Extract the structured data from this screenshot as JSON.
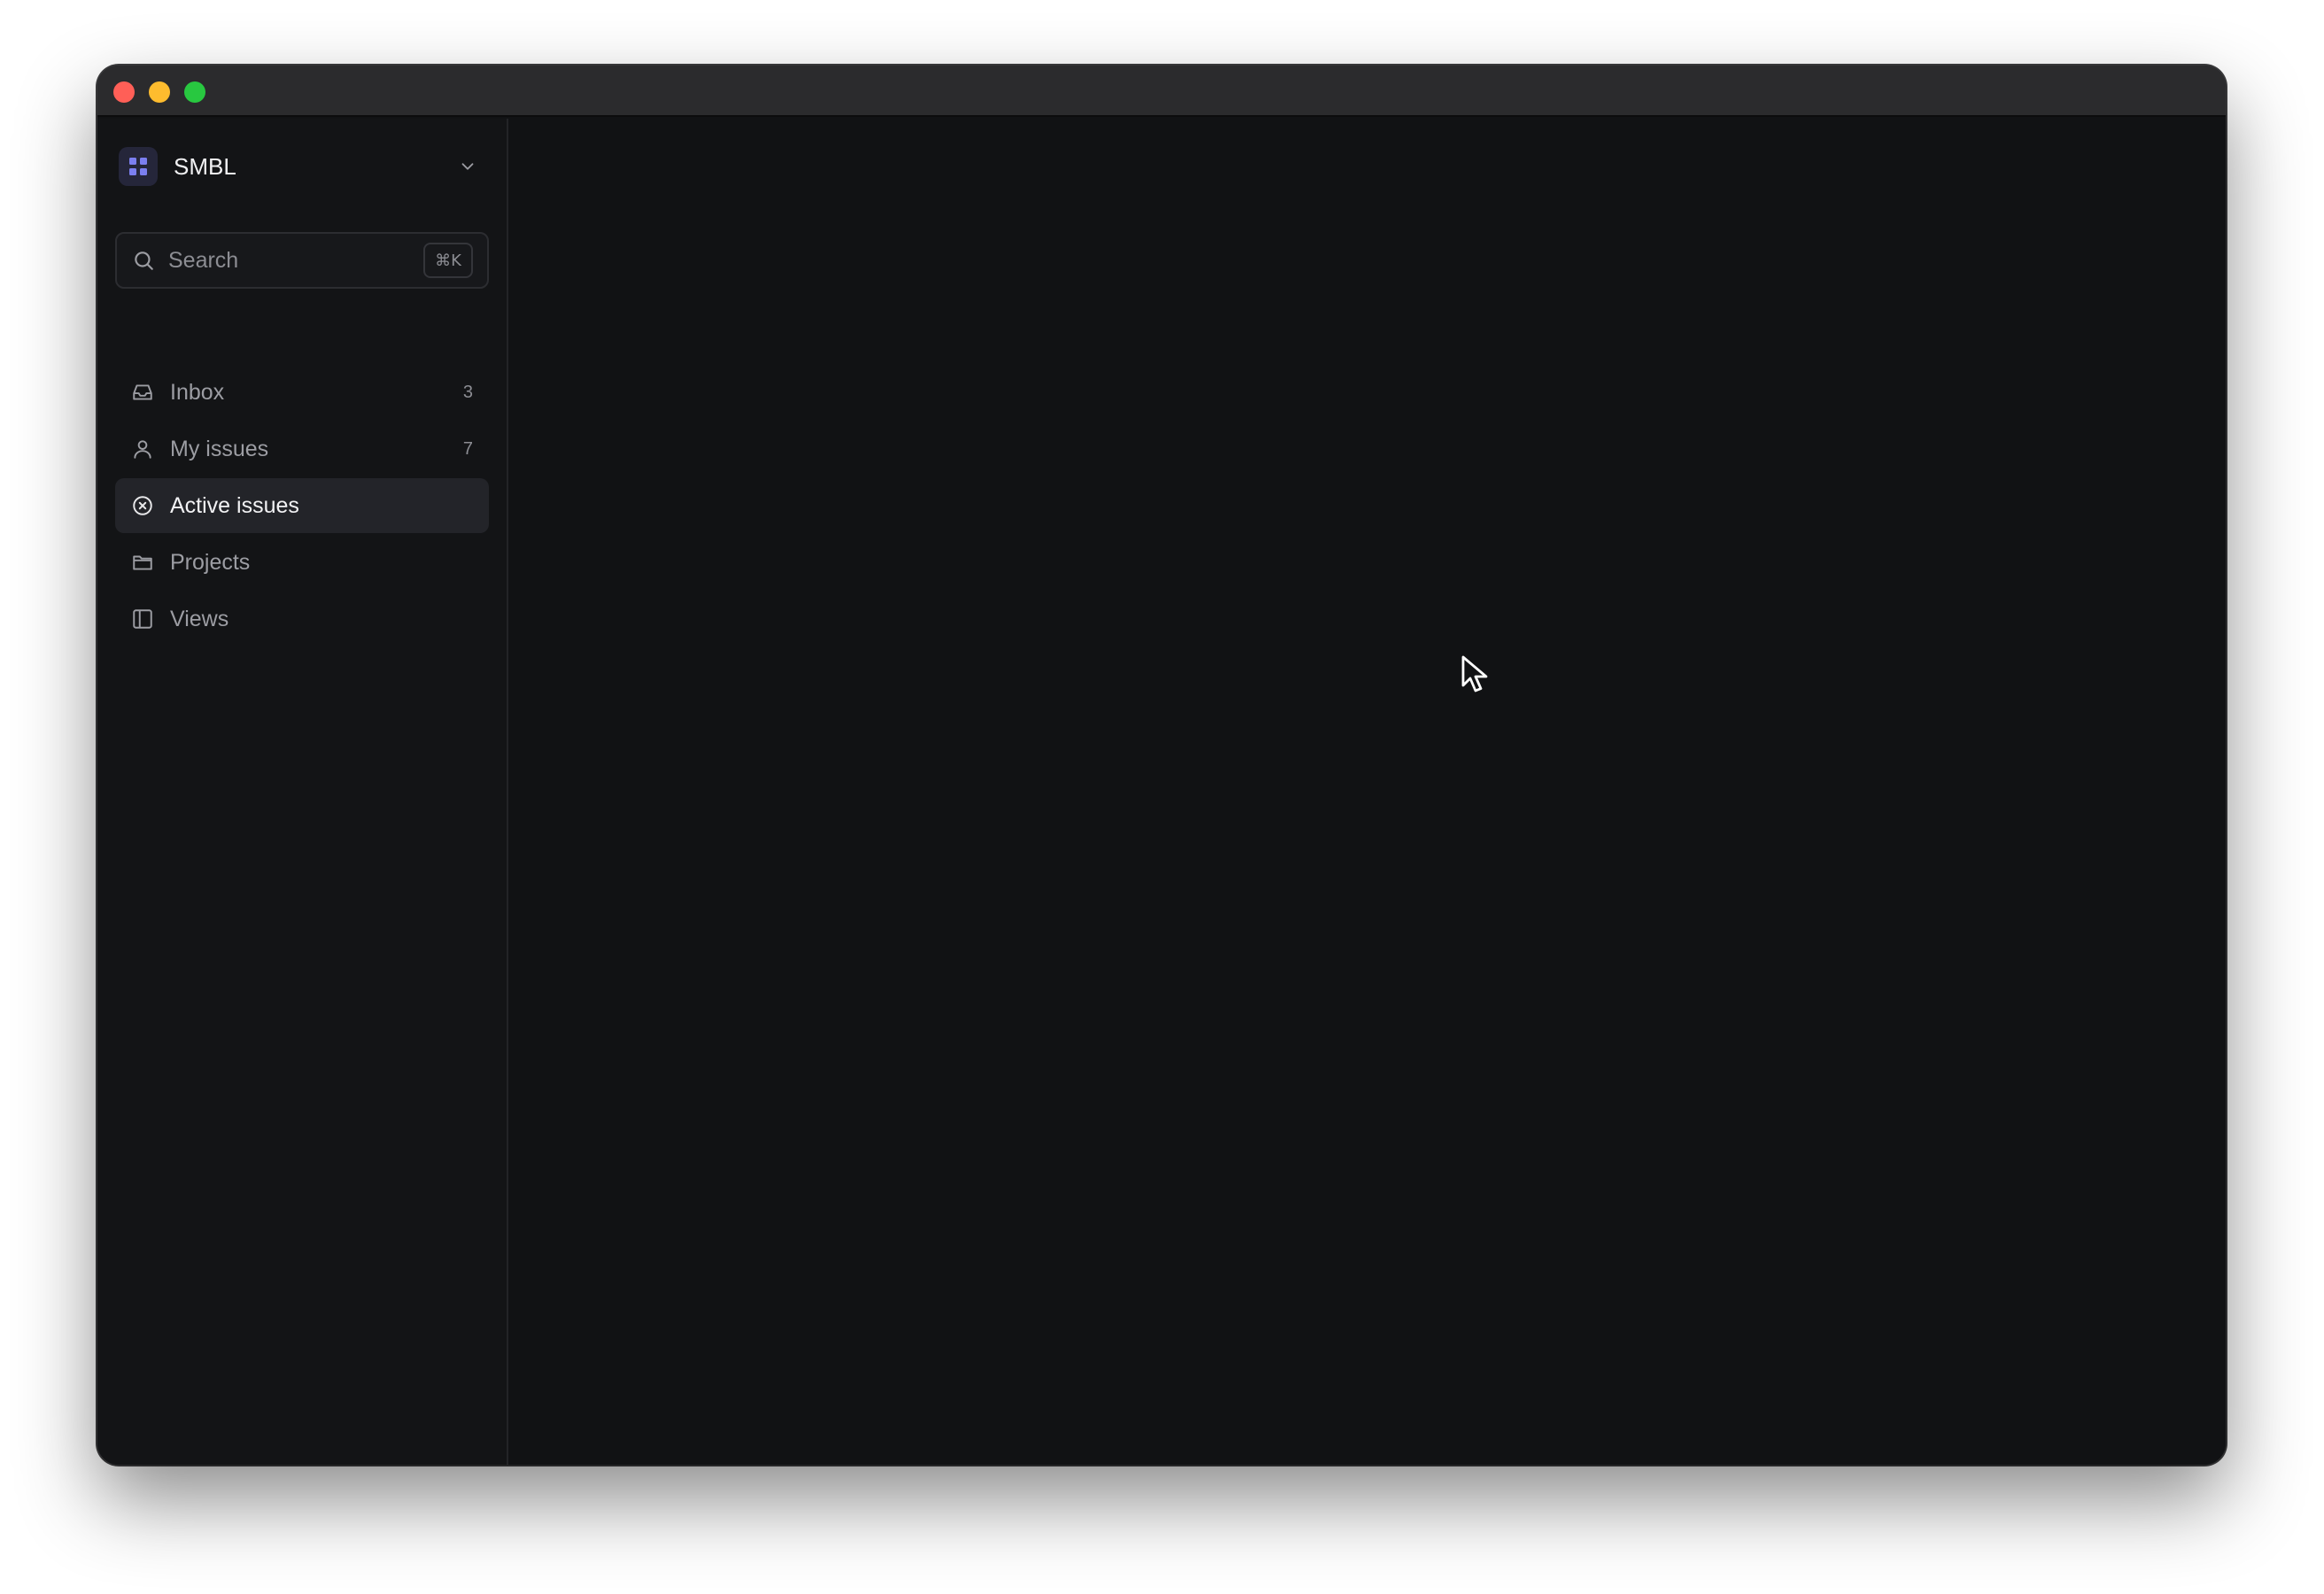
{
  "workspace": {
    "name": "SMBL"
  },
  "search": {
    "placeholder": "Search",
    "shortcut": "⌘K"
  },
  "nav": {
    "items": [
      {
        "label": "Inbox",
        "icon": "inbox-icon",
        "count": "3",
        "active": false
      },
      {
        "label": "My issues",
        "icon": "user-icon",
        "count": "7",
        "active": false
      },
      {
        "label": "Active issues",
        "icon": "circle-x-icon",
        "count": "",
        "active": true
      },
      {
        "label": "Projects",
        "icon": "folder-icon",
        "count": "",
        "active": false
      },
      {
        "label": "Views",
        "icon": "panel-icon",
        "count": "",
        "active": false
      }
    ]
  },
  "colors": {
    "accent": "#7b7ff0",
    "window_bg": "#111214",
    "sidebar_bg": "#131416",
    "active_item_bg": "#232429"
  }
}
